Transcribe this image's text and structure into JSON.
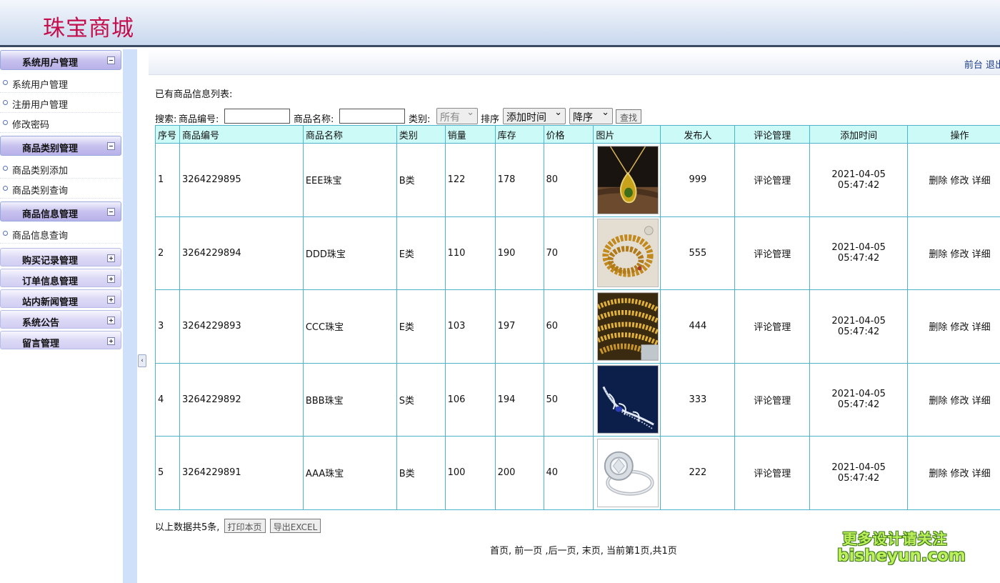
{
  "header": {
    "title": "珠宝商城"
  },
  "topbar": {
    "links": "前台 退出"
  },
  "sidebar": {
    "groups": [
      {
        "label": "系统用户管理",
        "items": [
          "系统用户管理",
          "注册用户管理",
          "修改密码"
        ]
      },
      {
        "label": "商品类别管理",
        "items": [
          "商品类别添加",
          "商品类别查询"
        ]
      },
      {
        "label": "商品信息管理",
        "items": [
          "商品信息查询"
        ]
      },
      {
        "label": "购买记录管理",
        "items": []
      },
      {
        "label": "订单信息管理",
        "items": []
      },
      {
        "label": "站内新闻管理",
        "items": []
      },
      {
        "label": "系统公告",
        "items": []
      },
      {
        "label": "留言管理",
        "items": []
      }
    ]
  },
  "page": {
    "list_title": "已有商品信息列表:"
  },
  "search": {
    "prefix": "搜索:",
    "code_label": "商品编号:",
    "code_value": "",
    "name_label": "商品名称:",
    "name_value": "",
    "category_label": "类别:",
    "category_value": "所有",
    "sort_label": "排序",
    "sort_field": "添加时间",
    "sort_order": "降序",
    "search_button": "查找"
  },
  "table": {
    "headers": [
      "序号",
      "商品编号",
      "商品名称",
      "类别",
      "销量",
      "库存",
      "价格",
      "图片",
      "发布人",
      "评论管理",
      "添加时间",
      "操作"
    ],
    "rows": [
      {
        "no": "1",
        "code": "3264229895",
        "name": "EEE珠宝",
        "category": "B类",
        "sales": "122",
        "stock": "178",
        "price": "80",
        "image": "amber-pendant",
        "publisher": "999",
        "comment": "评论管理",
        "time": "2021-04-05 05:47:42",
        "ops": "删除 修改 详细"
      },
      {
        "no": "2",
        "code": "3264229894",
        "name": "DDD珠宝",
        "category": "E类",
        "sales": "110",
        "stock": "190",
        "price": "70",
        "image": "bead-bracelet",
        "publisher": "555",
        "comment": "评论管理",
        "time": "2021-04-05 05:47:42",
        "ops": "删除 修改 详细"
      },
      {
        "no": "3",
        "code": "3264229893",
        "name": "CCC珠宝",
        "category": "E类",
        "sales": "103",
        "stock": "197",
        "price": "60",
        "image": "gold-chains",
        "publisher": "444",
        "comment": "评论管理",
        "time": "2021-04-05 05:47:42",
        "ops": "删除 修改 详细"
      },
      {
        "no": "4",
        "code": "3264229892",
        "name": "BBB珠宝",
        "category": "S类",
        "sales": "106",
        "stock": "194",
        "price": "50",
        "image": "sapphire-necklace",
        "publisher": "333",
        "comment": "评论管理",
        "time": "2021-04-05 05:47:42",
        "ops": "删除 修改 详细"
      },
      {
        "no": "5",
        "code": "3264229891",
        "name": "AAA珠宝",
        "category": "B类",
        "sales": "100",
        "stock": "200",
        "price": "40",
        "image": "diamond-ring",
        "publisher": "222",
        "comment": "评论管理",
        "time": "2021-04-05 05:47:42",
        "ops": "删除 修改 详细"
      }
    ]
  },
  "footer": {
    "total": "以上数据共5条,",
    "print_button": "打印本页",
    "export_button": "导出EXCEL",
    "pager": "首页, 前一页 ,后一页, 末页, 当前第1页,共1页"
  },
  "watermark": {
    "line1": "更多设计请关注",
    "line2": "bisheyun.com"
  }
}
